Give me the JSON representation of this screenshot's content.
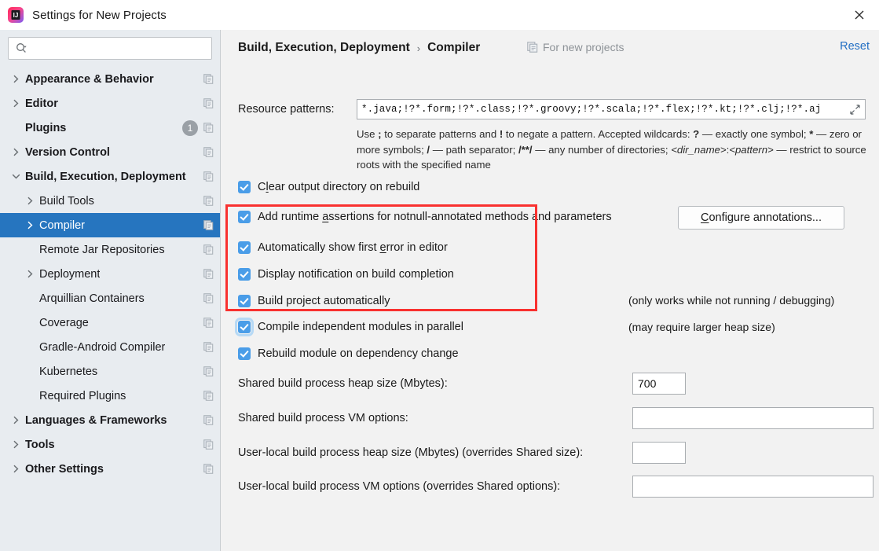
{
  "window": {
    "title": "Settings for New Projects",
    "app_icon": "intellij-idea-logo",
    "close_label": "✕"
  },
  "sidebar": {
    "search": {
      "placeholder": "",
      "value": "",
      "icon": "search-icon"
    },
    "items": [
      {
        "label": "Appearance & Behavior",
        "bold": true,
        "arrow": "right",
        "indent": 0,
        "copy_icon": true
      },
      {
        "label": "Editor",
        "bold": true,
        "arrow": "right",
        "indent": 0,
        "copy_icon": true
      },
      {
        "label": "Plugins",
        "bold": true,
        "arrow": "none",
        "indent": 0,
        "copy_icon": true,
        "badge": "1"
      },
      {
        "label": "Version Control",
        "bold": true,
        "arrow": "right",
        "indent": 0,
        "copy_icon": true
      },
      {
        "label": "Build, Execution, Deployment",
        "bold": true,
        "arrow": "down",
        "indent": 0,
        "copy_icon": true
      },
      {
        "label": "Build Tools",
        "bold": false,
        "arrow": "right",
        "indent": 1,
        "copy_icon": true
      },
      {
        "label": "Compiler",
        "bold": false,
        "arrow": "right",
        "indent": 1,
        "copy_icon": true,
        "selected": true
      },
      {
        "label": "Remote Jar Repositories",
        "bold": false,
        "arrow": "none",
        "indent": 1,
        "copy_icon": true
      },
      {
        "label": "Deployment",
        "bold": false,
        "arrow": "right",
        "indent": 1,
        "copy_icon": true
      },
      {
        "label": "Arquillian Containers",
        "bold": false,
        "arrow": "none",
        "indent": 1,
        "copy_icon": true
      },
      {
        "label": "Coverage",
        "bold": false,
        "arrow": "none",
        "indent": 1,
        "copy_icon": true
      },
      {
        "label": "Gradle-Android Compiler",
        "bold": false,
        "arrow": "none",
        "indent": 1,
        "copy_icon": true
      },
      {
        "label": "Kubernetes",
        "bold": false,
        "arrow": "none",
        "indent": 1,
        "copy_icon": true
      },
      {
        "label": "Required Plugins",
        "bold": false,
        "arrow": "none",
        "indent": 1,
        "copy_icon": true
      },
      {
        "label": "Languages & Frameworks",
        "bold": true,
        "arrow": "right",
        "indent": 0,
        "copy_icon": true
      },
      {
        "label": "Tools",
        "bold": true,
        "arrow": "right",
        "indent": 0,
        "copy_icon": true
      },
      {
        "label": "Other Settings",
        "bold": true,
        "arrow": "right",
        "indent": 0,
        "copy_icon": true
      }
    ]
  },
  "header": {
    "breadcrumb_root": "Build, Execution, Deployment",
    "breadcrumb_sep": "›",
    "breadcrumb_leaf": "Compiler",
    "scope_note": "For new projects",
    "scope_icon": "copy-pages-icon",
    "reset_label": "Reset"
  },
  "main": {
    "resource_patterns": {
      "label": "Resource patterns:",
      "value": "*.java;!?*.form;!?*.class;!?*.groovy;!?*.scala;!?*.flex;!?*.kt;!?*.clj;!?*.aj",
      "expand_icon": "expand-arrows-icon"
    },
    "hint_line1_a": "Use ",
    "hint_semicolon": ";",
    "hint_line1_b": " to separate patterns and ",
    "hint_bang": "!",
    "hint_line1_c": " to negate a pattern. Accepted wildcards: ",
    "hint_question": "?",
    "hint_line1_d": " — exactly one symbol; ",
    "hint_star": "*",
    "hint_line1_e": " — zero or more symbols; ",
    "hint_slash": "/",
    "hint_line2_a": " — path separator; ",
    "hint_globstar": "/**/",
    "hint_line2_b": " — any number of directories; ",
    "hint_dirname": "<dir_name>",
    "hint_colon": ":",
    "hint_pattern": "<pattern>",
    "hint_line3": " — restrict to source roots with the specified name",
    "checkboxes": [
      {
        "id": "clear-output-directory",
        "pre": "C",
        "mnemonic": "l",
        "post": "ear output directory on rebuild",
        "checked": true,
        "focused": false
      },
      {
        "id": "add-runtime-assertions",
        "pre": "Add runtime ",
        "mnemonic": "a",
        "post": "ssertions for notnull-annotated methods and parameters",
        "checked": true,
        "focused": false
      },
      {
        "id": "auto-show-first-error",
        "pre": "Automatically show first ",
        "mnemonic": "e",
        "post": "rror in editor",
        "checked": true,
        "focused": false
      },
      {
        "id": "display-notification-build-completion",
        "pre": "Display notification on build completion",
        "mnemonic": "",
        "post": "",
        "checked": true,
        "focused": false
      },
      {
        "id": "build-project-automatically",
        "pre": "Build project automatically",
        "mnemonic": "",
        "post": "",
        "checked": true,
        "focused": false
      },
      {
        "id": "compile-independent-modules-parallel",
        "pre": "Compile independent modules in parallel",
        "mnemonic": "",
        "post": "",
        "checked": true,
        "focused": true
      },
      {
        "id": "rebuild-module-on-dependency-change",
        "pre": "Rebuild module on dependency change",
        "mnemonic": "",
        "post": "",
        "checked": true,
        "focused": false
      }
    ],
    "configure_annotations": {
      "pre": "C",
      "mnemonic_char": "C",
      "label_rest": "onfigure annotations..."
    },
    "side_note_1": "(only works while not running / debugging)",
    "side_note_2": "(may require larger heap size)",
    "fields": [
      {
        "id": "shared-heap-size",
        "label": "Shared build process heap size (Mbytes):",
        "value": "700",
        "placeholder": "",
        "wide": false
      },
      {
        "id": "shared-vm-options",
        "label": "Shared build process VM options:",
        "value": "",
        "placeholder": "",
        "wide": true
      },
      {
        "id": "user-local-heap-size",
        "label": "User-local build process heap size (Mbytes) (overrides Shared size):",
        "value": "",
        "placeholder": "",
        "wide": false
      },
      {
        "id": "user-local-vm-options",
        "label": "User-local build process VM options (overrides Shared options):",
        "value": "",
        "placeholder": "",
        "wide": true
      }
    ]
  },
  "annotation": {
    "highlight_color": "#f9312f",
    "highlight_target": "compiler-checkbox-group"
  },
  "colors": {
    "accent_selection": "#2675bf",
    "checkbox_blue": "#4a9de8",
    "link_blue": "#2470c4",
    "sidebar_bg": "#e8ecf0",
    "content_bg": "#f2f2f2"
  }
}
